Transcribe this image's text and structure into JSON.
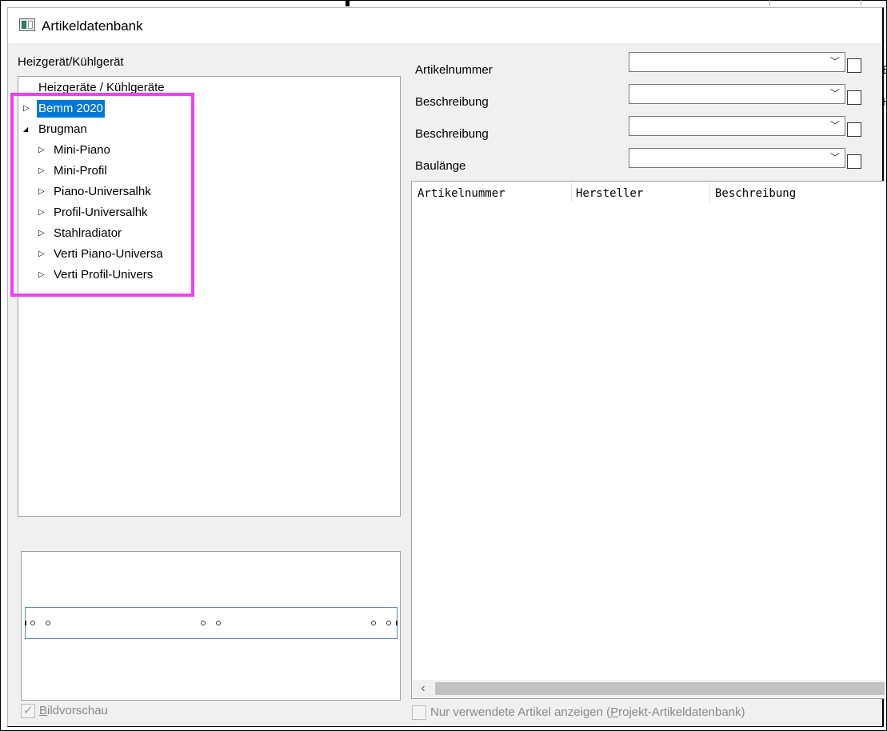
{
  "window": {
    "title": "Artikeldatenbank"
  },
  "left": {
    "group_label": "Heizgerät/Kühlgerät",
    "tree": {
      "root": "Heizgeräte / Kühlgeräte",
      "items": [
        {
          "label": "Bemm 2020",
          "level": 0,
          "state": "collapsed",
          "selected": true
        },
        {
          "label": "Brugman",
          "level": 0,
          "state": "expanded",
          "selected": false
        },
        {
          "label": "Mini-Piano",
          "level": 1,
          "state": "collapsed",
          "selected": false
        },
        {
          "label": "Mini-Profil",
          "level": 1,
          "state": "collapsed",
          "selected": false
        },
        {
          "label": "Piano-Universalhk",
          "level": 1,
          "state": "collapsed",
          "selected": false
        },
        {
          "label": "Profil-Universalhk",
          "level": 1,
          "state": "collapsed",
          "selected": false
        },
        {
          "label": "Stahlradiator",
          "level": 1,
          "state": "collapsed",
          "selected": false
        },
        {
          "label": "Verti Piano-Universa",
          "level": 1,
          "state": "collapsed",
          "selected": false
        },
        {
          "label": "Verti Profil-Univers",
          "level": 1,
          "state": "collapsed",
          "selected": false
        }
      ]
    },
    "preview_checkbox": {
      "label_underlined": "B",
      "label_rest": "ildvorschau",
      "checked": true,
      "enabled": false
    }
  },
  "filters": {
    "rows": [
      {
        "label": "Artikelnummer",
        "value": "",
        "checked": false
      },
      {
        "label": "Beschreibung",
        "value": "",
        "checked": false
      },
      {
        "label": "Beschreibung",
        "value": "",
        "checked": false
      },
      {
        "label": "Baulänge",
        "value": "",
        "checked": false
      }
    ],
    "cut_labels": [
      "E",
      "H"
    ]
  },
  "table": {
    "columns": [
      "Artikelnummer",
      "Hersteller",
      "Beschreibung"
    ],
    "rows": []
  },
  "bottom": {
    "only_used_prefix": "Nur verwendete Artikel anzeigen (",
    "only_used_underlined": "P",
    "only_used_suffix": "rojekt-Artikeldatenbank)",
    "checked": false,
    "enabled": false
  },
  "icons": {
    "expand_collapsed": "▷",
    "expand_expanded": "◢",
    "combo_arrow": "﹀",
    "scroll_left": "‹",
    "check": "✓"
  },
  "colors": {
    "selection": "#0078d7",
    "highlight": "#f13ff1",
    "window_bg": "#f0f0f0"
  }
}
